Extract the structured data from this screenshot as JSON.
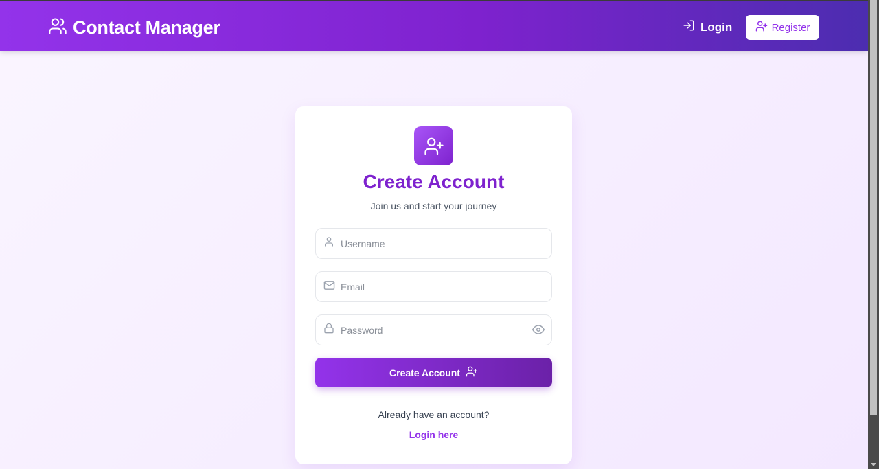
{
  "navbar": {
    "brand": "Contact Manager",
    "login_label": "Login",
    "register_label": "Register"
  },
  "card": {
    "title": "Create Account",
    "subtitle": "Join us and start your journey",
    "fields": {
      "username_placeholder": "Username",
      "email_placeholder": "Email",
      "password_placeholder": "Password"
    },
    "submit_label": "Create Account",
    "have_account_text": "Already have an account?",
    "login_link_label": "Login here"
  },
  "icons": {
    "brand": "users-icon",
    "nav_login": "log-in-icon",
    "nav_register": "user-plus-icon",
    "card": "user-plus-icon",
    "username": "user-icon",
    "email": "mail-icon",
    "password": "lock-icon",
    "toggle_password": "eye-icon",
    "submit": "user-plus-icon"
  },
  "colors": {
    "primary": "#9333ea",
    "primary_dark": "#7e22ce",
    "nav_end": "#4c2db0",
    "background": "#faf5ff"
  }
}
